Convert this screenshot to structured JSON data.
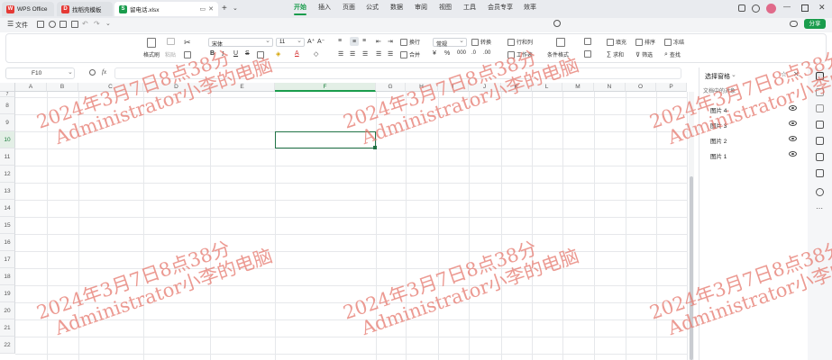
{
  "tabs": [
    {
      "label": "WPS Office",
      "color": "#e53935",
      "letter": "W"
    },
    {
      "label": "找稻壳模板",
      "color": "#e53935",
      "letter": "D"
    },
    {
      "label": "留电话.xlsx",
      "color": "#1a9c4c",
      "letter": "S"
    }
  ],
  "menu": {
    "file": "文件",
    "items": [
      "开始",
      "插入",
      "页面",
      "公式",
      "数据",
      "审阅",
      "视图",
      "工具",
      "会员专享",
      "效率"
    ],
    "active": "开始",
    "share": "分享"
  },
  "ribbon": {
    "format_painter": "格式刷",
    "paste": "粘贴",
    "font": "宋体",
    "size": "11",
    "wrap": "换行",
    "number_format": "常规",
    "convert": "转换",
    "row_col": "行和列",
    "merge": "合并",
    "sheet": "工作表",
    "cond_format": "条件格式",
    "fill": "填充",
    "sort": "排序",
    "freeze": "冻结",
    "sum": "求和",
    "filter": "筛选",
    "find": "查找"
  },
  "formula": {
    "cell_ref": "F10",
    "fx": "fx"
  },
  "grid": {
    "columns": [
      "A",
      "B",
      "C",
      "D",
      "E",
      "F",
      "G",
      "H",
      "I",
      "J",
      "K",
      "L",
      "M",
      "N",
      "O",
      "P"
    ],
    "rows": [
      "7",
      "8",
      "9",
      "10",
      "11",
      "12",
      "13",
      "14",
      "15",
      "16",
      "17",
      "18",
      "19",
      "20",
      "21",
      "22"
    ],
    "active_cell": "F10"
  },
  "panel": {
    "title": "选择窗格",
    "subtitle": "文档中的对象",
    "items": [
      "图片 4",
      "图片 3",
      "图片 2",
      "图片 1"
    ]
  },
  "watermark": {
    "line1": "2024年3月7日8点38分",
    "line2": "Administrator小李的电脑"
  },
  "colors": {
    "accent": "#1a9c4c",
    "watermark": "#e6786e"
  }
}
